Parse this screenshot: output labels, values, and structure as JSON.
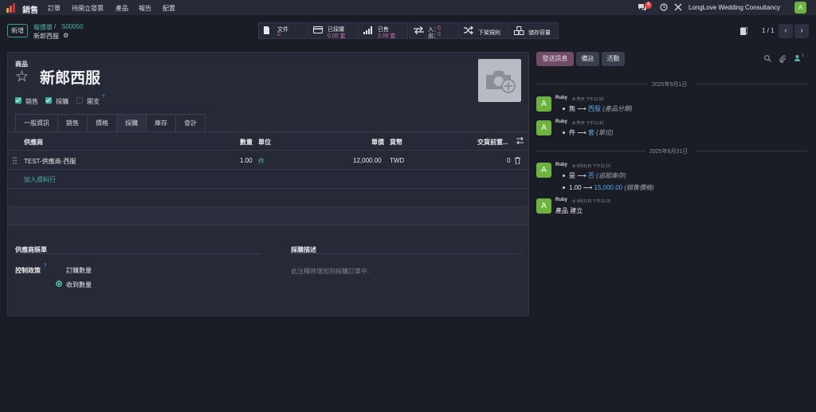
{
  "nav": {
    "app_name": "銷售",
    "menu": [
      "訂單",
      "待開立發票",
      "產品",
      "報告",
      "配置"
    ],
    "message_count": "4",
    "company": "LongLove Wedding Consultancy",
    "user_initial": "A"
  },
  "control": {
    "new_button": "新增",
    "breadcrumb_parent": "報價單",
    "breadcrumb_sep": "/",
    "breadcrumb_id": "S00050",
    "record_name": "新郎西服",
    "pager": "1 / 1"
  },
  "smart_buttons": [
    {
      "label": "文件",
      "value": "0"
    },
    {
      "label": "已採購",
      "value": "0.00 套"
    },
    {
      "label": "已售",
      "value": "2.00 套"
    },
    {
      "label": "入：",
      "value": "出：",
      "in_val": "0",
      "out_val": "0"
    },
    {
      "label": "下架規則",
      "value": ""
    },
    {
      "label": "儲存容量",
      "value": ""
    }
  ],
  "form": {
    "product_label": "商品",
    "product_name": "新郎西服",
    "options": [
      {
        "label": "銷售",
        "checked": true
      },
      {
        "label": "採購",
        "checked": true
      },
      {
        "label": "開支",
        "checked": false
      }
    ],
    "tabs": [
      "一般資訊",
      "銷售",
      "價格",
      "採購",
      "庫存",
      "會計"
    ],
    "active_tab": "採購",
    "table": {
      "headers": [
        "供應商",
        "數量",
        "單位",
        "單價",
        "貨幣",
        "交貨前置..."
      ],
      "rows": [
        {
          "vendor": "TEST-供應商-西服",
          "qty": "1.00",
          "unit": "件",
          "price": "12,000.00",
          "currency": "TWD",
          "lead": "0"
        }
      ],
      "add_line": "加入資料行"
    },
    "vendor_bill_section": "供應商賬單",
    "control_policy_label": "控制政策",
    "control_policy_options": [
      "訂購數量",
      "收到數量"
    ],
    "control_policy_selected": "收到數量",
    "purchase_desc_section": "採購描述",
    "purchase_desc_placeholder": "此注釋將增加到採購訂單中."
  },
  "chatter": {
    "send_message": "發送訊息",
    "log_note": "備註",
    "activity": "活動",
    "follower_count": "1",
    "groups": [
      {
        "date": "2025年9月1日",
        "messages": [
          {
            "author": "Ruby",
            "time": "昨天 下午11:50",
            "old": "無",
            "new": "西服",
            "field": "(產品分類)"
          },
          {
            "author": "Ruby",
            "time": "昨天 下午11:42",
            "old": "件",
            "new": "套",
            "field": "(單位)"
          }
        ]
      },
      {
        "date": "2025年8月31日",
        "messages": [
          {
            "author": "Ruby",
            "time": "8月31日 下午11:19",
            "changes": [
              {
                "old": "是",
                "new": "否",
                "field": "(追蹤庫存)"
              },
              {
                "old": "1.00",
                "new": "15,000.00",
                "field": "(銷售價格)"
              }
            ]
          },
          {
            "author": "Ruby",
            "time": "8月31日 下午11:18",
            "body": "產品 建立"
          }
        ]
      }
    ]
  },
  "colors": {
    "bg": "#1b1d26",
    "panel": "#262a36",
    "accent": "#3fb0a4",
    "primary_button": "#714b67",
    "link_new_value": "#5fa6e6",
    "smart_value": "#c66fb8",
    "avatar": "#6cb33f"
  }
}
